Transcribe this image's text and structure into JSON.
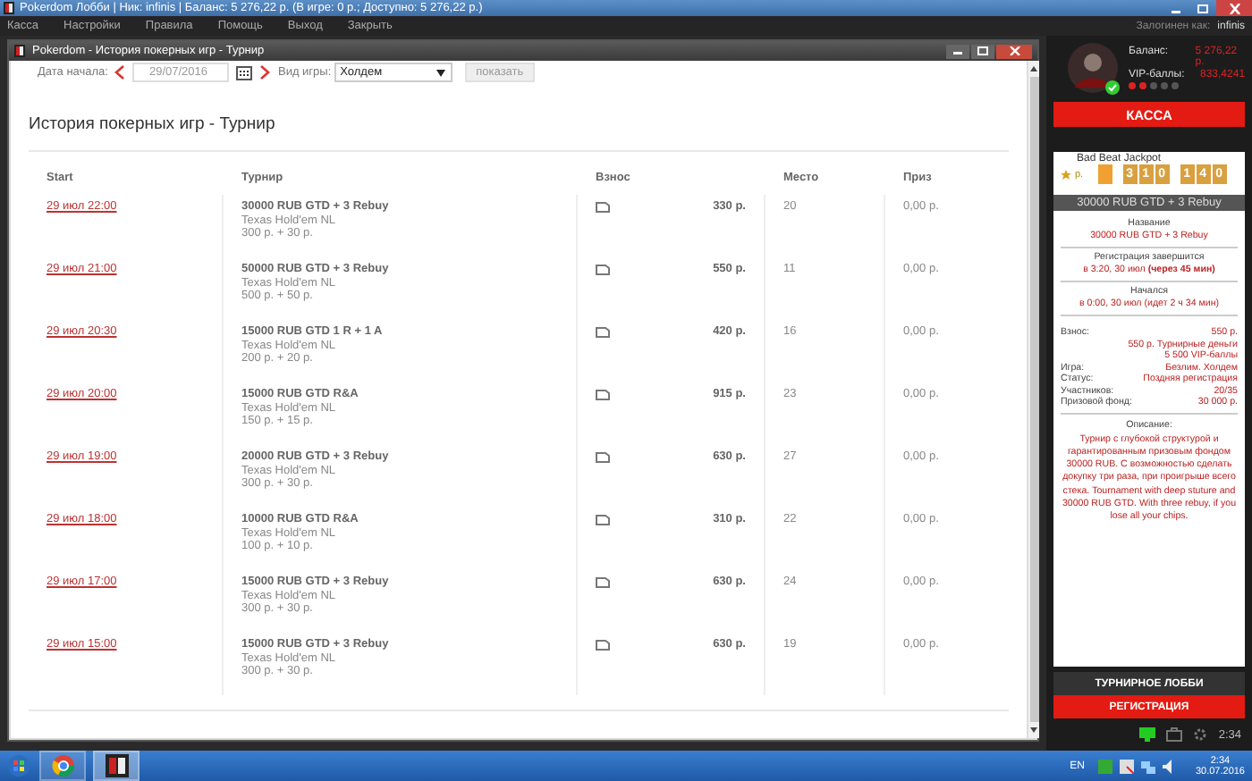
{
  "lobby_window": {
    "title": "Pokerdom Лобби | Ник: infinis | Баланс: 5 276,22 р. (В игре: 0 р.; Доступно: 5 276,22 р.)"
  },
  "menu": {
    "items": [
      "Касса",
      "Настройки",
      "Правила",
      "Помощь",
      "Выход",
      "Закрыть"
    ],
    "logged_in_label": "Залогинен как:",
    "username": "infinis"
  },
  "history_window": {
    "title": "Pokerdom - История покерных игр - Турнир",
    "filters": {
      "date_label": "Дата начала:",
      "date_value": "29/07/2016",
      "game_label": "Вид игры:",
      "game_value": "Холдем",
      "show_button": "показать"
    },
    "heading": "История покерных игр - Турнир",
    "table": {
      "columns": [
        "Start",
        "Турнир",
        "Взнос",
        "Место",
        "Приз"
      ],
      "rows": [
        {
          "start": "29 июл 22:00",
          "name": "30000 RUB GTD + 3 Rebuy",
          "game": "Texas Hold'em NL",
          "buyin": "300 р. + 30 р.",
          "fee": "330 р.",
          "place": "20",
          "prize": "0,00 р."
        },
        {
          "start": "29 июл 21:00",
          "name": "50000 RUB GTD + 3 Rebuy",
          "game": "Texas Hold'em NL",
          "buyin": "500 р. + 50 р.",
          "fee": "550 р.",
          "place": "11",
          "prize": "0,00 р."
        },
        {
          "start": "29 июл 20:30",
          "name": "15000 RUB GTD 1 R + 1 A",
          "game": "Texas Hold'em NL",
          "buyin": "200 р. + 20 р.",
          "fee": "420 р.",
          "place": "16",
          "prize": "0,00 р."
        },
        {
          "start": "29 июл 20:00",
          "name": "15000 RUB GTD R&A",
          "game": "Texas Hold'em NL",
          "buyin": "150 р. + 15 р.",
          "fee": "915 р.",
          "place": "23",
          "prize": "0,00 р."
        },
        {
          "start": "29 июл 19:00",
          "name": "20000 RUB GTD + 3 Rebuy",
          "game": "Texas Hold'em NL",
          "buyin": "300 р. + 30 р.",
          "fee": "630 р.",
          "place": "27",
          "prize": "0,00 р."
        },
        {
          "start": "29 июл 18:00",
          "name": "10000 RUB GTD R&A",
          "game": "Texas Hold'em NL",
          "buyin": "100 р. + 10 р.",
          "fee": "310 р.",
          "place": "22",
          "prize": "0,00 р."
        },
        {
          "start": "29 июл 17:00",
          "name": "15000 RUB GTD + 3 Rebuy",
          "game": "Texas Hold'em NL",
          "buyin": "300 р. + 30 р.",
          "fee": "630 р.",
          "place": "24",
          "prize": "0,00 р."
        },
        {
          "start": "29 июл 15:00",
          "name": "15000 RUB GTD + 3 Rebuy",
          "game": "Texas Hold'em NL",
          "buyin": "300 р. + 30 р.",
          "fee": "630 р.",
          "place": "19",
          "prize": "0,00 р."
        }
      ]
    }
  },
  "profile": {
    "balance_label": "Баланс:",
    "balance": "5 276,22 р.",
    "vip_label": "VIP-баллы:",
    "vip": "833,4241",
    "stars": 2,
    "cashier_button": "КАССА"
  },
  "jackpot": {
    "title": "Bad Beat Jackpot",
    "currency": "р.",
    "groups": [
      [
        "3",
        "1",
        "0"
      ],
      [
        "1",
        "4",
        "0"
      ]
    ]
  },
  "tournament": {
    "header": "30000 RUB GTD + 3 Rebuy",
    "sections": [
      {
        "label": "Название",
        "value": "30000 RUB GTD + 3 Rebuy"
      },
      {
        "label": "Регистрация завершится",
        "value": "в 3:20, 30 июл **(через 45 мин)**"
      },
      {
        "label": "Начался",
        "value": "в 0:00, 30 июл (идет 2 ч 34 мин)"
      }
    ],
    "details": [
      {
        "label": "Взнос:",
        "value": "550 р."
      },
      {
        "value": "550 р. Турнирные деньги"
      },
      {
        "value": "5 500 VIP-баллы"
      },
      {
        "label": "Игра:",
        "value": "Безлим. Холдем"
      },
      {
        "label": "Статус:",
        "value": "Поздняя регистрация"
      },
      {
        "label": "Участников:",
        "value": "20/35"
      },
      {
        "label": "Призовой фонд:",
        "value": "30 000 р."
      }
    ],
    "description_label": "Описание:",
    "description": "Турнир с глубокой структурой и гарантированным призовым фондом 30000 RUB. С возможностью сделать докупку три раза, при проигрыше всего стека. Tournament with deep stuture and 30000 RUB GTD. With three rebuy, if you lose all your chips."
  },
  "buttons": [
    {
      "label": "ТУРНИРНОЕ ЛОББИ",
      "kind": "secondary"
    },
    {
      "label": "РЕГИСТРАЦИЯ",
      "kind": "primary"
    }
  ],
  "lobby_tray": {
    "time": "2:34"
  },
  "taskbar": {
    "language": "EN",
    "time": "2:34",
    "date": "30.07.2016"
  }
}
